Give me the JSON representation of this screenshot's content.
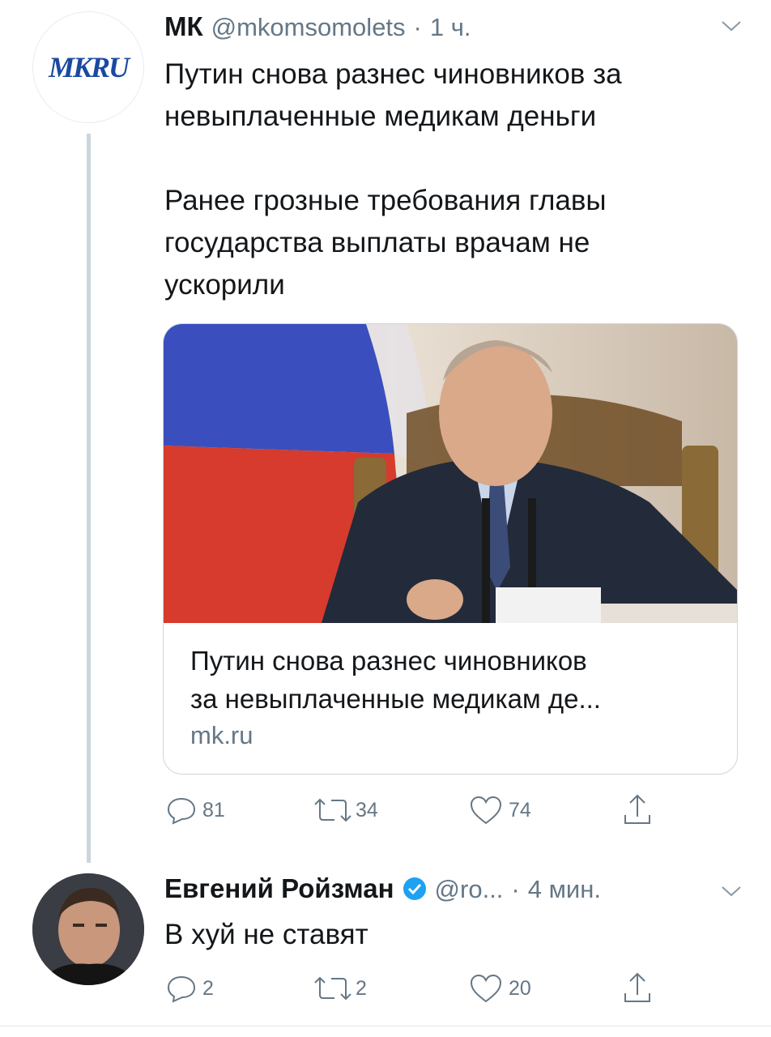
{
  "tweet1": {
    "author_name": "МК",
    "author_handle": "@mkomsomolets",
    "dot": "·",
    "time": "1 ч.",
    "avatar_logo": "MKRU",
    "text_line1": "Путин снова разнес чиновников за",
    "text_line2": "невыплаченные медикам деньги",
    "text_line3": "Ранее грозные требования главы",
    "text_line4": "государства выплаты врачам не",
    "text_line5": "ускорили",
    "card": {
      "title_line1": "Путин снова разнес чиновников",
      "title_line2": "за невыплаченные медикам де...",
      "domain": "mk.ru"
    },
    "actions": {
      "replies": "81",
      "retweets": "34",
      "likes": "74"
    }
  },
  "tweet2": {
    "author_name": "Евгений Ройзман",
    "author_handle": "@ro...",
    "dot": "·",
    "time": "4 мин.",
    "text": "В хуй не ставят",
    "actions": {
      "replies": "2",
      "retweets": "2",
      "likes": "20"
    }
  },
  "icons": [
    "chevron-down-icon",
    "reply-icon",
    "retweet-icon",
    "like-icon",
    "share-icon",
    "verified-badge-icon"
  ],
  "colors": {
    "text": "#14171a",
    "secondary": "#657786",
    "border": "#ccd6dd",
    "verified": "#1da1f2",
    "logo_blue": "#1a4aa0"
  }
}
